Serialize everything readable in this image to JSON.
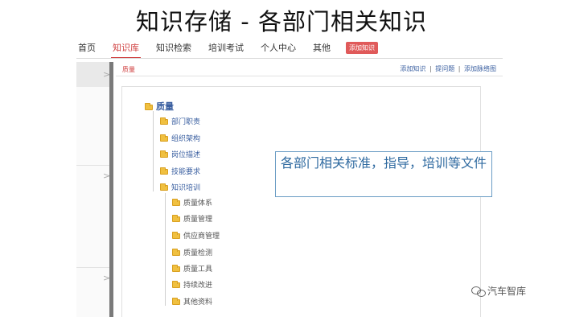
{
  "slide": {
    "title": "知识存储 - 各部门相关知识"
  },
  "topnav": {
    "items": [
      "首页",
      "知识库",
      "知识检索",
      "培训考试",
      "个人中心",
      "其他"
    ],
    "active_index": 1,
    "add_button": "添加知识"
  },
  "sidebar": {
    "chevrons": [
      ">",
      ">",
      ">"
    ]
  },
  "content_header": {
    "breadcrumb": "质量",
    "actions": [
      "添加知识",
      "提问题",
      "添加脉络图"
    ],
    "separator": "|"
  },
  "tree": {
    "root": "质量",
    "level1": [
      "部门职责",
      "组织架构",
      "岗位描述",
      "技能要求",
      "知识培训"
    ],
    "level2": [
      "质量体系",
      "质量管理",
      "供应商管理",
      "质量检测",
      "质量工具",
      "持续改进",
      "其他资料"
    ]
  },
  "callout": {
    "text": "各部门相关标准，指导，培训等文件"
  },
  "watermark": {
    "text": "汽车智库"
  },
  "colors": {
    "accent_red": "#d04040",
    "link_blue": "#3a5fa0",
    "callout_blue": "#2f6aa0",
    "folder_yellow": "#f0c040"
  }
}
